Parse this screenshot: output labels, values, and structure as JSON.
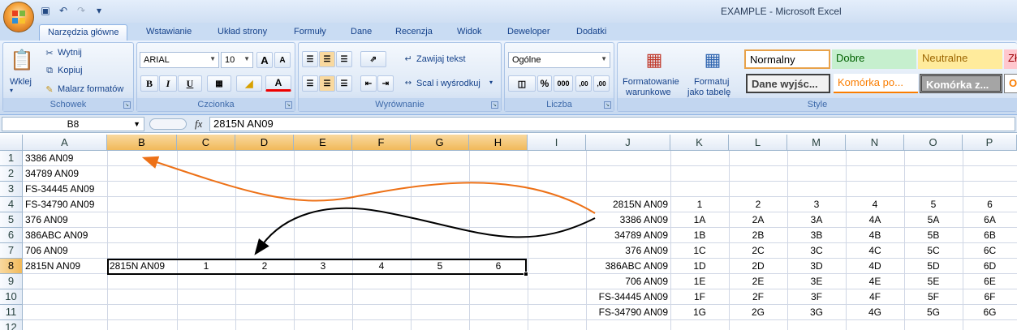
{
  "window": {
    "title": "EXAMPLE - Microsoft Excel",
    "qat": [
      "save-icon",
      "undo-icon",
      "redo-icon",
      "customize-icon"
    ]
  },
  "tabs": [
    {
      "label": "Narzędzia główne",
      "active": true
    },
    {
      "label": "Wstawianie"
    },
    {
      "label": "Układ strony"
    },
    {
      "label": "Formuły"
    },
    {
      "label": "Dane"
    },
    {
      "label": "Recenzja"
    },
    {
      "label": "Widok"
    },
    {
      "label": "Deweloper"
    },
    {
      "label": "Dodatki"
    }
  ],
  "ribbon": {
    "clipboard": {
      "label": "Schowek",
      "paste": "Wklej",
      "cut": "Wytnij",
      "copy": "Kopiuj",
      "painter": "Malarz formatów"
    },
    "font": {
      "label": "Czcionka",
      "name": "ARIAL",
      "size": "10",
      "bold": "B",
      "italic": "I",
      "underline": "U",
      "grow": "A",
      "shrink": "A",
      "color_glyph": "A"
    },
    "alignment": {
      "label": "Wyrównanie",
      "wrap": "Zawijaj tekst",
      "merge": "Scal i wyśrodkuj"
    },
    "number": {
      "label": "Liczba",
      "format": "Ogólne",
      "percent": "%",
      "thousands": "000",
      "inc": ",00",
      "dec": ",00"
    },
    "styles": {
      "label": "Style",
      "conditional": "Formatowanie",
      "conditional2": "warunkowe",
      "as_table": "Formatuj",
      "as_table2": "jako tabelę",
      "cells": [
        {
          "text": "Normalny",
          "bg": "#ffffff",
          "fg": "#000000"
        },
        {
          "text": "Dobre",
          "bg": "#c6efce",
          "fg": "#006100"
        },
        {
          "text": "Neutralne",
          "bg": "#ffeb9c",
          "fg": "#9c6500"
        },
        {
          "text": "Zł",
          "bg": "#ffc7ce",
          "fg": "#9c0006"
        },
        {
          "text": "Dane wyjśc...",
          "bg": "#f2f2f2",
          "fg": "#3f3f3f"
        },
        {
          "text": "Komórka po...",
          "bg": "#ffffff",
          "fg": "#fa7d00"
        },
        {
          "text": "Komórka z...",
          "bg": "#a5a5a5",
          "fg": "#ffffff"
        },
        {
          "text": "O",
          "bg": "#ffffff",
          "fg": "#fa7d00"
        }
      ]
    }
  },
  "formula_bar": {
    "name_box": "B8",
    "fx": "fx",
    "formula": "2815N  AN09"
  },
  "grid": {
    "columns": [
      "A",
      "B",
      "C",
      "D",
      "E",
      "F",
      "G",
      "H",
      "I",
      "J",
      "K",
      "L",
      "M",
      "N",
      "O",
      "P"
    ],
    "rows": [
      "1",
      "2",
      "3",
      "4",
      "5",
      "6",
      "7",
      "8",
      "9",
      "10",
      "11",
      "12"
    ],
    "selected_column": "B",
    "selected_row": "8",
    "col_a": [
      "3386  AN09",
      "34789  AN09",
      "FS-34445  AN09",
      "FS-34790  AN09",
      "376  AN09",
      "386ABC  AN09",
      "706  AN09",
      "2815N  AN09"
    ],
    "row8": [
      "2815N  AN09",
      "1",
      "2",
      "3",
      "4",
      "5",
      "6"
    ],
    "table_header": [
      "2815N  AN09",
      "1",
      "2",
      "3",
      "4",
      "5",
      "6"
    ],
    "table_rows": [
      [
        "3386  AN09",
        "1A",
        "2A",
        "3A",
        "4A",
        "5A",
        "6A"
      ],
      [
        "34789  AN09",
        "1B",
        "2B",
        "3B",
        "4B",
        "5B",
        "6B"
      ],
      [
        "376  AN09",
        "1C",
        "2C",
        "3C",
        "4C",
        "5C",
        "6C"
      ],
      [
        "386ABC  AN09",
        "1D",
        "2D",
        "3D",
        "4D",
        "5D",
        "6D"
      ],
      [
        "706  AN09",
        "1E",
        "2E",
        "3E",
        "4E",
        "5E",
        "6E"
      ],
      [
        "FS-34445  AN09",
        "1F",
        "2F",
        "3F",
        "4F",
        "5F",
        "6F"
      ],
      [
        "FS-34790  AN09",
        "1G",
        "2G",
        "3G",
        "4G",
        "5G",
        "6G"
      ]
    ]
  },
  "annotations": {
    "orange_arrow_color": "#ed7117",
    "black_arrow_color": "#000000"
  }
}
